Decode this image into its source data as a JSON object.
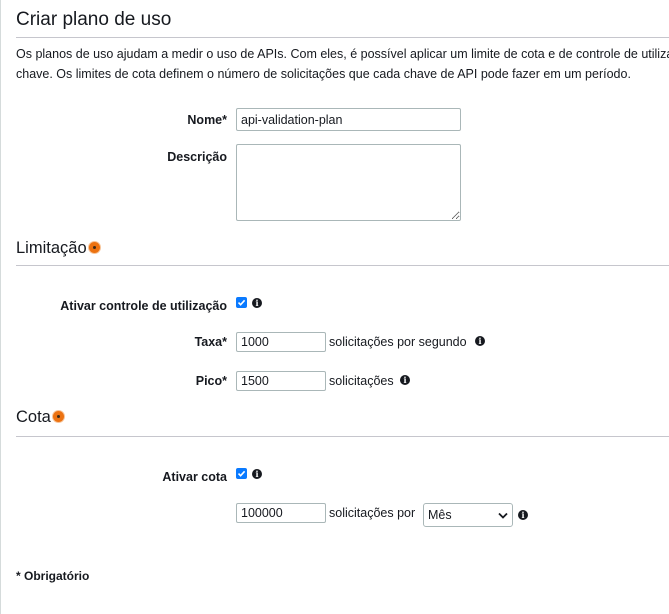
{
  "title": "Criar plano de uso",
  "description": "Os planos de uso ajudam a medir o uso de APIs. Com eles, é possível aplicar um limite de cota e de controle de utilização para cada chave. Os limites de cota definem o número de solicitações que cada chave de API pode fazer em um período.",
  "description_line1": "Os planos de uso ajudam a medir o uso de APIs. Com eles, é possível aplicar um limite de cota e de controle de utilização para cada",
  "description_line2": "chave. Os limites de cota definem o número de solicitações que cada chave de API pode fazer em um período.",
  "form": {
    "name_label": "Nome*",
    "name_value": "api-validation-plan",
    "desc_label": "Descrição",
    "desc_value": ""
  },
  "throttling": {
    "heading": "Limitação",
    "enable_label": "Ativar controle de utilização",
    "enabled": true,
    "rate_label": "Taxa*",
    "rate_value": "1000",
    "rate_unit": "solicitações por segundo",
    "burst_label": "Pico*",
    "burst_value": "1500",
    "burst_unit": "solicitações"
  },
  "quota": {
    "heading": "Cota",
    "enable_label": "Ativar cota",
    "enabled": true,
    "value": "100000",
    "unit": "solicitações por",
    "period_selected": "Mês"
  },
  "required_note": "* Obrigatório",
  "colors": {
    "accent_dot": "#ec7211",
    "checkbox": "#0a7aff"
  }
}
